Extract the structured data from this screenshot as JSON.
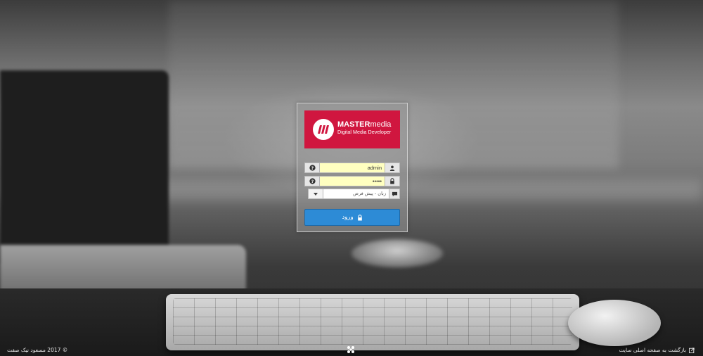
{
  "login": {
    "logo": {
      "brand_bold": "MASTER",
      "brand_light": "media",
      "tagline": "Digital Media Developer",
      "color": "#d0163f"
    },
    "username": {
      "value": "admin",
      "icon": "user-icon",
      "help_icon": "question-circle-icon"
    },
    "password": {
      "value": "•••••",
      "icon": "lock-icon",
      "help_icon": "question-circle-icon"
    },
    "language": {
      "selected": "زبان - پیش فرض",
      "icon": "comment-icon",
      "chevron": "chevron-down-icon"
    },
    "submit": {
      "label": "ورود",
      "icon": "lock-icon",
      "color": "#2d8bd6"
    }
  },
  "footer": {
    "copyright": "© 2017 مسعود نیک صفت",
    "back_link": "بازگشت به صفحه اصلی سایت",
    "back_icon": "external-link-icon",
    "center_icon": "joomla-icon"
  }
}
